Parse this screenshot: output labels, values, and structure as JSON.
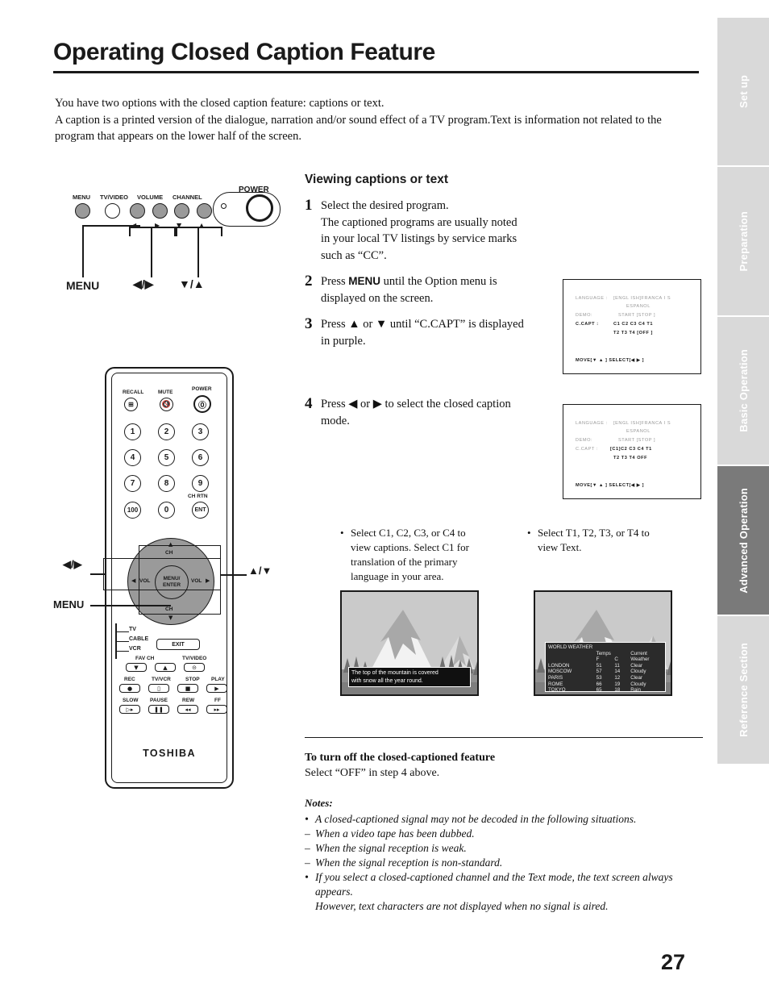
{
  "page": {
    "title": "Operating Closed Caption Feature",
    "number": "27",
    "intro": [
      "You have two options with the closed caption feature: captions or text.",
      "A caption is a printed version of the dialogue, narration and/or sound effect of a TV program.Text is information not related to the program that appears on the lower half of the screen."
    ]
  },
  "tabs": [
    {
      "label": "Set up",
      "active": false
    },
    {
      "label": "Preparation",
      "active": false
    },
    {
      "label": "Basic Operation",
      "active": false
    },
    {
      "label": "Advanced Operation",
      "active": true
    },
    {
      "label": "Reference Section",
      "active": false
    }
  ],
  "panel_diagram": {
    "buttons": [
      "MENU",
      "TV/VIDEO",
      "VOLUME",
      "CHANNEL"
    ],
    "power_label": "POWER",
    "callouts": [
      "MENU",
      "◀/▶",
      "▼/▲"
    ]
  },
  "remote": {
    "brand": "TOSHIBA",
    "top_labels": [
      "RECALL",
      "MUTE",
      "POWER"
    ],
    "keys": [
      "1",
      "2",
      "3",
      "4",
      "5",
      "6",
      "7",
      "8",
      "9",
      "100",
      "0",
      "ENT"
    ],
    "ent_label": "CH RTN",
    "pad": {
      "center": [
        "MENU/",
        "ENTER"
      ],
      "up": "CH",
      "down": "CH",
      "left": "VOL",
      "right": "VOL"
    },
    "mode_labels": [
      "TV",
      "CABLE",
      "VCR"
    ],
    "exit_label": "EXIT",
    "fav_row": [
      "FAV CH",
      "TV/VIDEO"
    ],
    "vcr_row": [
      "REC",
      "TV/VCR",
      "STOP",
      "PLAY"
    ],
    "trans_row": [
      "SLOW",
      "PAUSE",
      "REW",
      "FF"
    ],
    "callouts": [
      "◀/▶",
      "▲/▼",
      "MENU"
    ]
  },
  "section": {
    "heading": "Viewing captions or text",
    "steps": [
      {
        "num": "1",
        "lines": [
          "Select the desired program.",
          "The captioned programs are usually noted",
          "in your local TV listings by service marks",
          "such as “CC”."
        ]
      },
      {
        "num": "2",
        "pre": "Press ",
        "bold": "MENU",
        "post": " until the Option menu is",
        "lines2": [
          "displayed on the screen."
        ]
      },
      {
        "num": "3",
        "lines": [
          "Press ▲ or ▼ until “C.CAPT” is displayed",
          "in purple."
        ]
      },
      {
        "num": "4",
        "lines": [
          "Press ◀ or ▶ to select the closed caption",
          "mode."
        ]
      }
    ]
  },
  "osd1": {
    "language_label": "LANGUAGE :",
    "language_values": "[ENGL ISH]FRANCA I S",
    "language_values2": "ESPANOL",
    "demo_label": "DEMO:",
    "demo_values": "START [STOP ]",
    "ccapt_label": "C.CAPT :",
    "ccapt_row1": "C1  C2  C3  C4  T1",
    "ccapt_row2": "T2  T3  T4 [OFF ]",
    "footer": "MOVE[▼ ▲ ]  SELECT[◀ ▶ ]"
  },
  "osd2": {
    "language_label": "LANGUAGE :",
    "language_values": "[ENGL ISH]FRANCA I S",
    "language_values2": "ESPANOL",
    "demo_label": "DEMO:",
    "demo_values": "START [STOP ]",
    "ccapt_label": "C.CAPT :",
    "ccapt_row1": "[C1]C2  C3  C4  T1",
    "ccapt_row2": "T2  T3  T4  OFF",
    "footer": "MOVE[▼ ▲ ]  SELECT[◀ ▶ ]"
  },
  "bullets": [
    {
      "lines": [
        "Select C1, C2, C3, or C4 to",
        "view captions. Select C1 for",
        "translation of the primary",
        "language in your area."
      ]
    },
    {
      "lines": [
        "Select T1, T2, T3, or T4 to",
        "view Text."
      ]
    }
  ],
  "tv_caption": {
    "line1": "The top of the mountain is covered",
    "line2": "with snow all the year round."
  },
  "tv_text": {
    "title": "WORLD WEATHER",
    "header_temps": "Temps",
    "header_current": "Current",
    "header_f": "F",
    "header_c": "C",
    "header_weather": "Weather",
    "rows": [
      {
        "city": "LONDON",
        "f": "51",
        "c": "11",
        "weather": "Clear"
      },
      {
        "city": "MOSCOW",
        "f": "57",
        "c": "14",
        "weather": "Cloudy"
      },
      {
        "city": "PARIS",
        "f": "53",
        "c": "12",
        "weather": "Clear"
      },
      {
        "city": "ROME",
        "f": "66",
        "c": "19",
        "weather": "Cloudy"
      },
      {
        "city": "TOKYO",
        "f": "65",
        "c": "18",
        "weather": "Rain"
      }
    ]
  },
  "footer": {
    "turn_off_heading": "To turn off the closed-captioned feature",
    "turn_off_text": "Select “OFF” in step 4 above.",
    "notes_title": "Notes:",
    "notes": [
      {
        "mark": "•",
        "text": "A closed-captioned signal may not be decoded in the following situations."
      },
      {
        "mark": "–",
        "text": "When a video tape has been dubbed."
      },
      {
        "mark": "–",
        "text": "When the signal reception is weak."
      },
      {
        "mark": "–",
        "text": "When the signal reception is non-standard."
      },
      {
        "mark": "•",
        "text": "If you select a closed-captioned channel and the Text mode, the text screen always"
      },
      {
        "mark": "",
        "text": "appears."
      },
      {
        "mark": "",
        "text": "However, text characters are not displayed when no signal is aired."
      }
    ]
  },
  "colors": {
    "tab_inactive": "#d9d9d9",
    "tab_active": "#7a7a7a",
    "ink": "#1a1a1a",
    "osd_dim": "#9a9a9a"
  }
}
